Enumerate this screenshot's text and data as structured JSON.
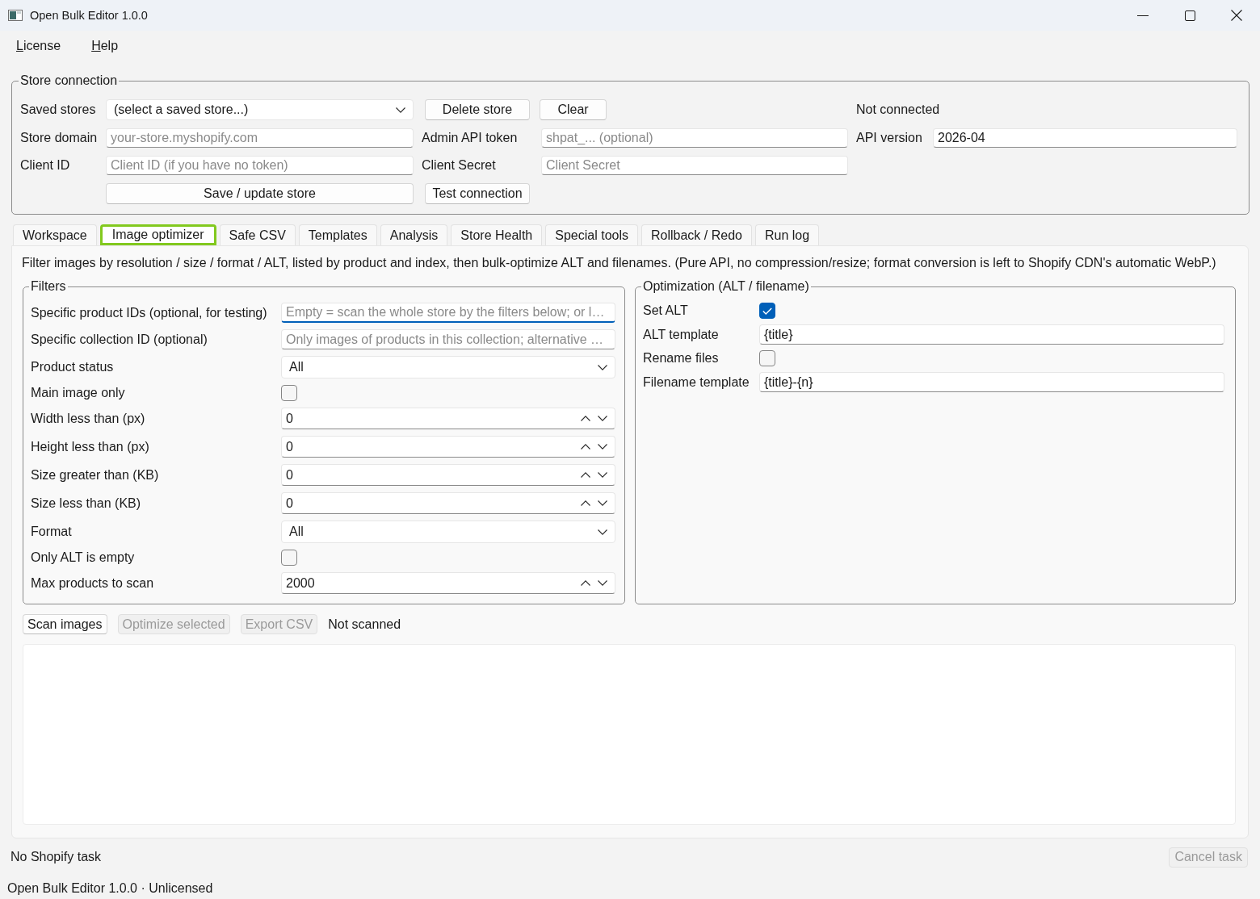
{
  "window": {
    "title": "Open Bulk Editor 1.0.0"
  },
  "menu": [
    {
      "label": "License"
    },
    {
      "label": "Help"
    }
  ],
  "store_connection": {
    "title": "Store connection",
    "saved_stores": {
      "label": "Saved stores",
      "value": "(select a saved store...)"
    },
    "delete_button": "Delete store",
    "clear_button": "Clear",
    "connection_status": "Not connected",
    "store_domain": {
      "label": "Store domain",
      "placeholder": "your-store.myshopify.com"
    },
    "admin_api_token": {
      "label": "Admin API token",
      "placeholder": "shpat_... (optional)"
    },
    "api_version": {
      "label": "API version",
      "value": "2026-04"
    },
    "client_id": {
      "label": "Client ID",
      "placeholder": "Client ID (if you have no token)"
    },
    "client_secret": {
      "label": "Client Secret",
      "placeholder": "Client Secret"
    },
    "save_button": "Save / update store",
    "test_button": "Test connection"
  },
  "tabs": [
    {
      "label": "Workspace",
      "selected": false
    },
    {
      "label": "Image optimizer",
      "selected": true
    },
    {
      "label": "Safe CSV",
      "selected": false
    },
    {
      "label": "Templates",
      "selected": false
    },
    {
      "label": "Analysis",
      "selected": false
    },
    {
      "label": "Store Health",
      "selected": false
    },
    {
      "label": "Special tools",
      "selected": false
    },
    {
      "label": "Rollback / Redo",
      "selected": false
    },
    {
      "label": "Run log",
      "selected": false
    }
  ],
  "image_optimizer": {
    "description": "Filter images by resolution / size / format / ALT, listed by product and index, then bulk-optimize ALT and filenames. (Pure API, no compression/resize; format conversion is left to Shopify CDN's automatic WebP.)",
    "filters": {
      "title": "Filters",
      "rows": [
        {
          "kind": "text",
          "label": "Specific product IDs (optional, for testing)",
          "placeholder": "Empty = scan the whole store by the filters below; or l…",
          "focused": true
        },
        {
          "kind": "text",
          "label": "Specific collection ID (optional)",
          "placeholder": "Only images of products in this collection; alternative …",
          "focused": false
        },
        {
          "kind": "select",
          "label": "Product status",
          "value": "All"
        },
        {
          "kind": "checkbox",
          "label": "Main image only",
          "checked": false
        },
        {
          "kind": "spin",
          "label": "Width less than (px)",
          "value": "0"
        },
        {
          "kind": "spin",
          "label": "Height less than (px)",
          "value": "0"
        },
        {
          "kind": "spin",
          "label": "Size greater than (KB)",
          "value": "0"
        },
        {
          "kind": "spin",
          "label": "Size less than (KB)",
          "value": "0"
        },
        {
          "kind": "select",
          "label": "Format",
          "value": "All"
        },
        {
          "kind": "checkbox",
          "label": "Only ALT is empty",
          "checked": false
        },
        {
          "kind": "spin",
          "label": "Max products to scan",
          "value": "2000"
        }
      ]
    },
    "optimization": {
      "title": "Optimization (ALT / filename)",
      "rows": [
        {
          "kind": "checkbox",
          "label": "Set ALT",
          "checked": true
        },
        {
          "kind": "text",
          "label": "ALT template",
          "value": "{title}",
          "focused": false
        },
        {
          "kind": "checkbox",
          "label": "Rename files",
          "checked": false
        },
        {
          "kind": "text",
          "label": "Filename template",
          "value": "{title}-{n}",
          "focused": false
        }
      ]
    },
    "actions": [
      {
        "label": "Scan images",
        "disabled": false
      },
      {
        "label": "Optimize selected",
        "disabled": true
      },
      {
        "label": "Export CSV",
        "disabled": true
      }
    ],
    "scan_status": "Not scanned"
  },
  "task_status": "No Shopify task",
  "cancel_button": {
    "label": "Cancel task",
    "disabled": true
  },
  "status_bar": "Open Bulk Editor 1.0.0 · Unlicensed"
}
